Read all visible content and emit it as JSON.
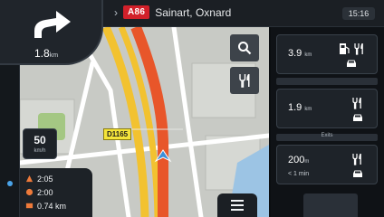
{
  "topbar": {
    "street_prefix_icon": "chevron-right-icon",
    "road_badge": "A86",
    "street_name": "Sainart, Oxnard",
    "clock": "15:16"
  },
  "turn": {
    "icon": "turn-right-arrow-icon",
    "distance_value": "1.8",
    "distance_unit": "km"
  },
  "speed_limit": {
    "value": "50",
    "unit": "km/h"
  },
  "trip": [
    {
      "icon": "distance-icon",
      "value": "2:05"
    },
    {
      "icon": "eta-icon",
      "value": "2:00"
    },
    {
      "icon": "remaining-icon",
      "value": "0.74 km"
    }
  ],
  "map": {
    "search_icon": "search-icon",
    "poi_icon": "fork-knife-icon",
    "menu_icon": "hamburger-menu-icon",
    "sign_label": "D1165"
  },
  "services": [
    {
      "distance": "3.9",
      "unit": "km",
      "sub": "",
      "icons": [
        "fuel-icon",
        "restaurant-icon",
        "car-icon"
      ]
    },
    {
      "distance": "1.9",
      "unit": "km",
      "sub": "",
      "icons": [
        "restaurant-icon",
        "car-icon"
      ]
    },
    {
      "distance": "200",
      "unit": "m",
      "sub": "< 1 min",
      "icons": [
        "restaurant-icon",
        "car-icon"
      ]
    }
  ],
  "services_separator": "Exits",
  "colors": {
    "route": "#e8562a",
    "highway": "#f2c230",
    "panel": "#1e2329",
    "badge": "#d2202a"
  }
}
